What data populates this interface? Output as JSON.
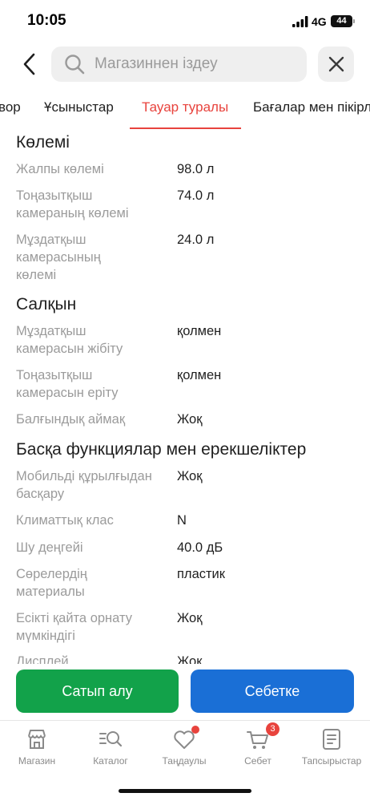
{
  "status": {
    "time": "10:05",
    "network": "4G",
    "battery": "44"
  },
  "header": {
    "search_placeholder": "Магазиннен іздеу"
  },
  "tabs": [
    {
      "label": "вор"
    },
    {
      "label": "Ұсыныстар"
    },
    {
      "label": "Тауар туралы",
      "active": true
    },
    {
      "label": "Бағалар мен пікірлер"
    }
  ],
  "sections": [
    {
      "title": "Көлемі",
      "rows": [
        {
          "label": "Жалпы көлемі",
          "value": "98.0 л"
        },
        {
          "label": "Тоңазытқыш камераның көлемі",
          "value": "74.0 л"
        },
        {
          "label": "Мұздатқыш камерасының көлемі",
          "value": "24.0 л"
        }
      ]
    },
    {
      "title": "Салқын",
      "rows": [
        {
          "label": "Мұздатқыш камерасын жібіту",
          "value": "қолмен"
        },
        {
          "label": "Тоңазытқыш камерасын еріту",
          "value": "қолмен"
        },
        {
          "label": "Балғындық аймақ",
          "value": "Жоқ"
        }
      ]
    },
    {
      "title": "Басқа функциялар мен ерекшеліктер",
      "rows": [
        {
          "label": "Мобильді құрылғыдан басқару",
          "value": "Жоқ"
        },
        {
          "label": "Климаттық клас",
          "value": "N"
        },
        {
          "label": "Шу деңгейі",
          "value": "40.0 дБ"
        },
        {
          "label": "Сөрелердің материалы",
          "value": "пластик"
        },
        {
          "label": "Есікті қайта орнату мүмкіндігі",
          "value": "Жоқ"
        },
        {
          "label": "Дисплей",
          "value": "Жоқ"
        }
      ]
    }
  ],
  "actions": {
    "buy_label": "Сатып алу",
    "cart_label": "Себетке"
  },
  "nav": [
    {
      "label": "Магазин",
      "icon": "shop-icon"
    },
    {
      "label": "Каталог",
      "icon": "catalog-search-icon"
    },
    {
      "label": "Таңдаулы",
      "icon": "heart-icon"
    },
    {
      "label": "Себет",
      "icon": "cart-icon",
      "badge": "3"
    },
    {
      "label": "Тапсырыстар",
      "icon": "orders-icon"
    }
  ],
  "colors": {
    "accent": "#e8433d",
    "buy": "#12a24a",
    "cart": "#1a6fd6",
    "muted": "#9b9b9b"
  }
}
